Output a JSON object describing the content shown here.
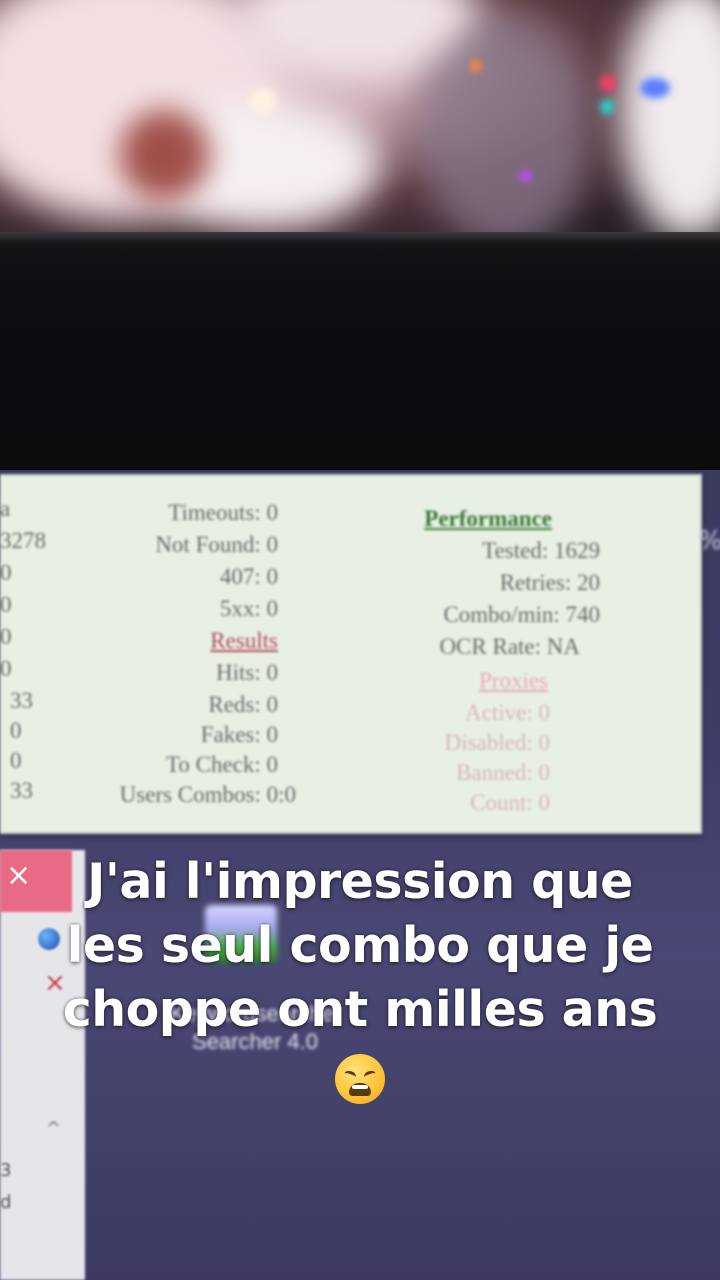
{
  "stats_panel": {
    "left_column": [
      "a",
      "3278",
      "0",
      "0",
      "0",
      "0",
      "33",
      "0",
      "0",
      "33"
    ],
    "middle_column": {
      "timeouts": "Timeouts: 0",
      "not_found": "Not Found: 0",
      "code_407": "407: 0",
      "code_5xx": "5xx: 0",
      "results_heading": "Results",
      "hits": "Hits: 0",
      "reds": "Reds: 0",
      "fakes": "Fakes: 0",
      "to_check": "To Check: 0",
      "users_combos": "Users Combos: 0:0"
    },
    "right_column": {
      "performance_heading": "Performance",
      "tested": "Tested: 1629",
      "retries": "Retries: 20",
      "combo_min": "Combo/min: 740",
      "ocr_rate": "OCR Rate: NA",
      "proxies_heading": "Proxies",
      "active": "Active: 0",
      "disabled": "Disabled: 0",
      "banned": "Banned: 0",
      "count": "Count: 0"
    }
  },
  "left_window": {
    "close_glyph": "×",
    "error_glyph": "×",
    "fragments": [
      "3",
      "d"
    ],
    "chevron": "^"
  },
  "desktop_shortcut": {
    "label_line1": "Keywordsearcher",
    "label_line2": "Searcher 4.0",
    "icon": "app-shortcut-icon"
  },
  "caption": {
    "line1": "J'ai l'impression que",
    "line2": "les seul combo que je",
    "line3": "choppe ont milles ans",
    "emoji": "weary-face-emoji"
  },
  "right_edge_glyph": "%"
}
